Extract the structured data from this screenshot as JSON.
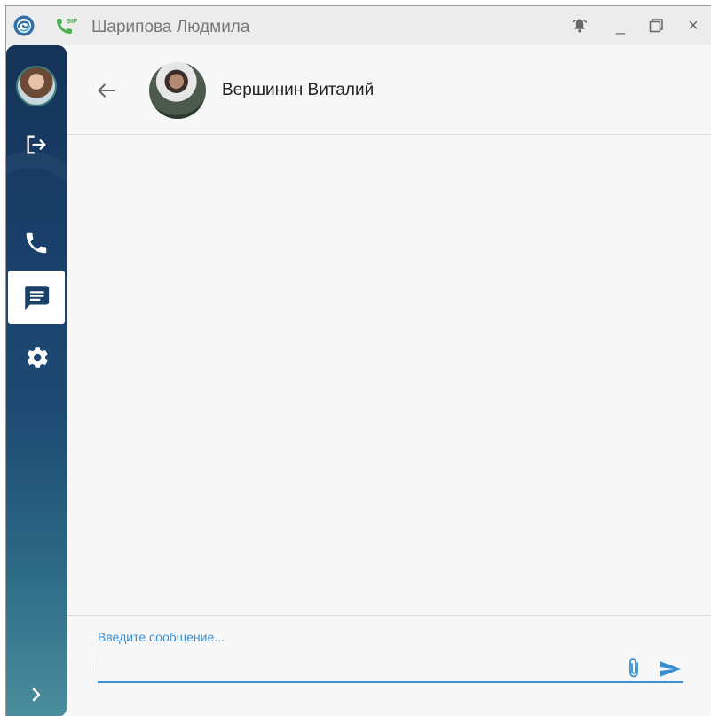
{
  "window": {
    "title": "Шарипова Людмила"
  },
  "titlebar": {
    "app_icon": "app-logo-icon",
    "sip_icon": "sip-phone-icon",
    "sip_badge": "SIP",
    "buttons": [
      "bell-icon",
      "minimize-icon",
      "maximize-icon",
      "close-icon"
    ],
    "minimize_glyph": "_",
    "close_glyph": "×"
  },
  "sidebar": {
    "items": [
      {
        "icon": "user-avatar"
      },
      {
        "icon": "logout-icon"
      },
      {
        "icon": "phone-icon"
      },
      {
        "icon": "chat-icon",
        "active": true
      },
      {
        "icon": "gear-icon"
      }
    ],
    "expand_glyph": "›"
  },
  "chat": {
    "contact_name": "Вершинин Виталий",
    "messages": []
  },
  "composer": {
    "label": "Введите сообщение...",
    "value": ""
  },
  "colors": {
    "accent": "#3a8fd1",
    "sidebar_top": "#153358",
    "sidebar_bottom": "#4b8e9c",
    "sip_green": "#4caf50"
  }
}
